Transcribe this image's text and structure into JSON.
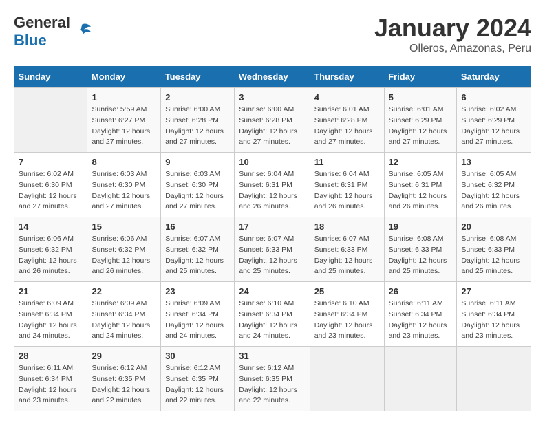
{
  "header": {
    "logo": {
      "text_general": "General",
      "text_blue": "Blue"
    },
    "title": "January 2024",
    "subtitle": "Olleros, Amazonas, Peru"
  },
  "calendar": {
    "weekdays": [
      "Sunday",
      "Monday",
      "Tuesday",
      "Wednesday",
      "Thursday",
      "Friday",
      "Saturday"
    ],
    "weeks": [
      [
        {
          "day": "",
          "empty": true
        },
        {
          "day": "1",
          "sunrise": "Sunrise: 5:59 AM",
          "sunset": "Sunset: 6:27 PM",
          "daylight": "Daylight: 12 hours and 27 minutes."
        },
        {
          "day": "2",
          "sunrise": "Sunrise: 6:00 AM",
          "sunset": "Sunset: 6:28 PM",
          "daylight": "Daylight: 12 hours and 27 minutes."
        },
        {
          "day": "3",
          "sunrise": "Sunrise: 6:00 AM",
          "sunset": "Sunset: 6:28 PM",
          "daylight": "Daylight: 12 hours and 27 minutes."
        },
        {
          "day": "4",
          "sunrise": "Sunrise: 6:01 AM",
          "sunset": "Sunset: 6:28 PM",
          "daylight": "Daylight: 12 hours and 27 minutes."
        },
        {
          "day": "5",
          "sunrise": "Sunrise: 6:01 AM",
          "sunset": "Sunset: 6:29 PM",
          "daylight": "Daylight: 12 hours and 27 minutes."
        },
        {
          "day": "6",
          "sunrise": "Sunrise: 6:02 AM",
          "sunset": "Sunset: 6:29 PM",
          "daylight": "Daylight: 12 hours and 27 minutes."
        }
      ],
      [
        {
          "day": "7",
          "sunrise": "Sunrise: 6:02 AM",
          "sunset": "Sunset: 6:30 PM",
          "daylight": "Daylight: 12 hours and 27 minutes."
        },
        {
          "day": "8",
          "sunrise": "Sunrise: 6:03 AM",
          "sunset": "Sunset: 6:30 PM",
          "daylight": "Daylight: 12 hours and 27 minutes."
        },
        {
          "day": "9",
          "sunrise": "Sunrise: 6:03 AM",
          "sunset": "Sunset: 6:30 PM",
          "daylight": "Daylight: 12 hours and 27 minutes."
        },
        {
          "day": "10",
          "sunrise": "Sunrise: 6:04 AM",
          "sunset": "Sunset: 6:31 PM",
          "daylight": "Daylight: 12 hours and 26 minutes."
        },
        {
          "day": "11",
          "sunrise": "Sunrise: 6:04 AM",
          "sunset": "Sunset: 6:31 PM",
          "daylight": "Daylight: 12 hours and 26 minutes."
        },
        {
          "day": "12",
          "sunrise": "Sunrise: 6:05 AM",
          "sunset": "Sunset: 6:31 PM",
          "daylight": "Daylight: 12 hours and 26 minutes."
        },
        {
          "day": "13",
          "sunrise": "Sunrise: 6:05 AM",
          "sunset": "Sunset: 6:32 PM",
          "daylight": "Daylight: 12 hours and 26 minutes."
        }
      ],
      [
        {
          "day": "14",
          "sunrise": "Sunrise: 6:06 AM",
          "sunset": "Sunset: 6:32 PM",
          "daylight": "Daylight: 12 hours and 26 minutes."
        },
        {
          "day": "15",
          "sunrise": "Sunrise: 6:06 AM",
          "sunset": "Sunset: 6:32 PM",
          "daylight": "Daylight: 12 hours and 26 minutes."
        },
        {
          "day": "16",
          "sunrise": "Sunrise: 6:07 AM",
          "sunset": "Sunset: 6:32 PM",
          "daylight": "Daylight: 12 hours and 25 minutes."
        },
        {
          "day": "17",
          "sunrise": "Sunrise: 6:07 AM",
          "sunset": "Sunset: 6:33 PM",
          "daylight": "Daylight: 12 hours and 25 minutes."
        },
        {
          "day": "18",
          "sunrise": "Sunrise: 6:07 AM",
          "sunset": "Sunset: 6:33 PM",
          "daylight": "Daylight: 12 hours and 25 minutes."
        },
        {
          "day": "19",
          "sunrise": "Sunrise: 6:08 AM",
          "sunset": "Sunset: 6:33 PM",
          "daylight": "Daylight: 12 hours and 25 minutes."
        },
        {
          "day": "20",
          "sunrise": "Sunrise: 6:08 AM",
          "sunset": "Sunset: 6:33 PM",
          "daylight": "Daylight: 12 hours and 25 minutes."
        }
      ],
      [
        {
          "day": "21",
          "sunrise": "Sunrise: 6:09 AM",
          "sunset": "Sunset: 6:34 PM",
          "daylight": "Daylight: 12 hours and 24 minutes."
        },
        {
          "day": "22",
          "sunrise": "Sunrise: 6:09 AM",
          "sunset": "Sunset: 6:34 PM",
          "daylight": "Daylight: 12 hours and 24 minutes."
        },
        {
          "day": "23",
          "sunrise": "Sunrise: 6:09 AM",
          "sunset": "Sunset: 6:34 PM",
          "daylight": "Daylight: 12 hours and 24 minutes."
        },
        {
          "day": "24",
          "sunrise": "Sunrise: 6:10 AM",
          "sunset": "Sunset: 6:34 PM",
          "daylight": "Daylight: 12 hours and 24 minutes."
        },
        {
          "day": "25",
          "sunrise": "Sunrise: 6:10 AM",
          "sunset": "Sunset: 6:34 PM",
          "daylight": "Daylight: 12 hours and 23 minutes."
        },
        {
          "day": "26",
          "sunrise": "Sunrise: 6:11 AM",
          "sunset": "Sunset: 6:34 PM",
          "daylight": "Daylight: 12 hours and 23 minutes."
        },
        {
          "day": "27",
          "sunrise": "Sunrise: 6:11 AM",
          "sunset": "Sunset: 6:34 PM",
          "daylight": "Daylight: 12 hours and 23 minutes."
        }
      ],
      [
        {
          "day": "28",
          "sunrise": "Sunrise: 6:11 AM",
          "sunset": "Sunset: 6:34 PM",
          "daylight": "Daylight: 12 hours and 23 minutes."
        },
        {
          "day": "29",
          "sunrise": "Sunrise: 6:12 AM",
          "sunset": "Sunset: 6:35 PM",
          "daylight": "Daylight: 12 hours and 22 minutes."
        },
        {
          "day": "30",
          "sunrise": "Sunrise: 6:12 AM",
          "sunset": "Sunset: 6:35 PM",
          "daylight": "Daylight: 12 hours and 22 minutes."
        },
        {
          "day": "31",
          "sunrise": "Sunrise: 6:12 AM",
          "sunset": "Sunset: 6:35 PM",
          "daylight": "Daylight: 12 hours and 22 minutes."
        },
        {
          "day": "",
          "empty": true
        },
        {
          "day": "",
          "empty": true
        },
        {
          "day": "",
          "empty": true
        }
      ]
    ]
  }
}
